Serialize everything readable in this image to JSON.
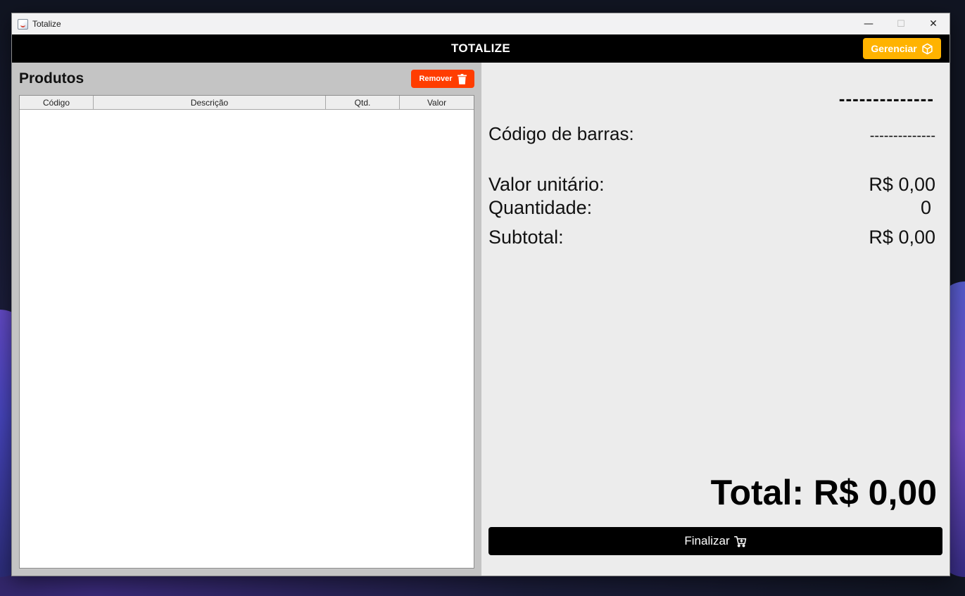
{
  "window": {
    "title": "Totalize",
    "controls": {
      "minimize": "—",
      "maximize": "☐",
      "close": "✕"
    }
  },
  "header": {
    "title": "TOTALIZE",
    "manage_label": "Gerenciar",
    "manage_icon": "box-icon",
    "bar_color": "#000000",
    "manage_color": "#ffb300"
  },
  "products": {
    "title": "Produtos",
    "remove_label": "Remover",
    "remove_icon": "trash-icon",
    "remove_color": "#ff3d00",
    "columns": [
      "Código",
      "Descrição",
      "Qtd.",
      "Valor"
    ],
    "rows": []
  },
  "detail": {
    "product_name": "--------------",
    "barcode_label": "Código de barras:",
    "barcode_value": "--------------",
    "unit_price_label": "Valor unitário:",
    "unit_price_value": "R$ 0,00",
    "quantity_label": "Quantidade:",
    "quantity_value": "0",
    "subtotal_label": "Subtotal:",
    "subtotal_value": "R$ 0,00",
    "total": "Total: R$ 0,00",
    "finish_label": "Finalizar",
    "finish_icon": "cart-icon"
  }
}
